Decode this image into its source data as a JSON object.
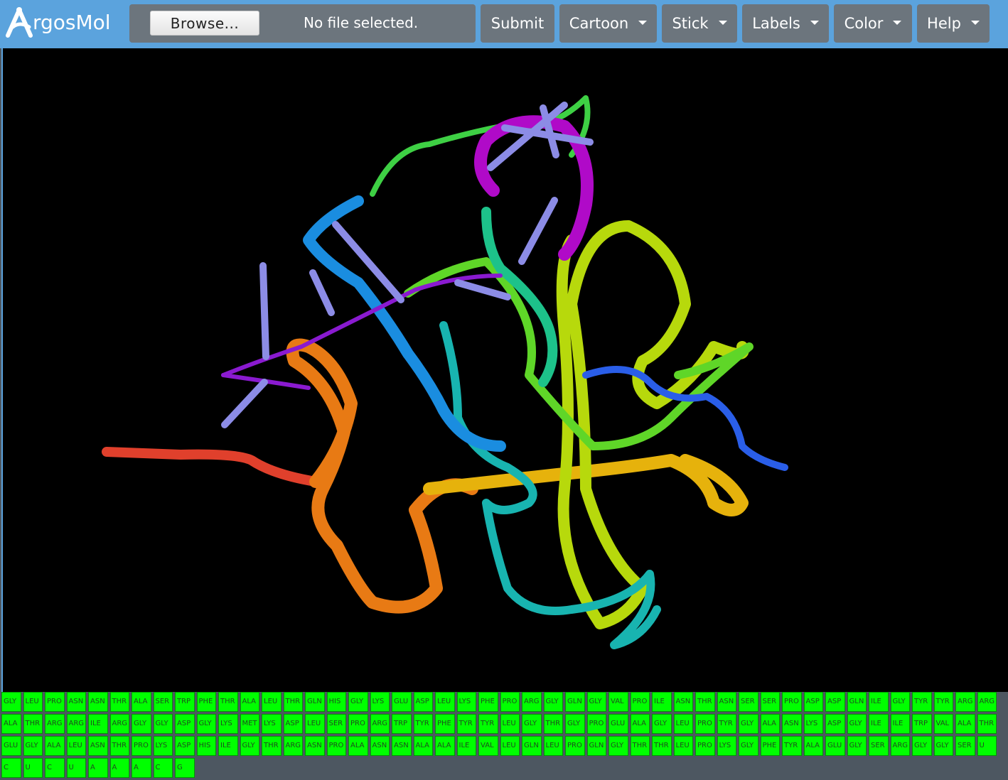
{
  "app": {
    "logo_text": "rgosMol",
    "logo_letter": "A"
  },
  "toolbar": {
    "browse_label": "Browse...",
    "file_status": "No file selected.",
    "submit_label": "Submit",
    "menus": [
      {
        "label": "Cartoon"
      },
      {
        "label": "Stick"
      },
      {
        "label": "Labels"
      },
      {
        "label": "Color"
      },
      {
        "label": "Help"
      }
    ]
  },
  "colors": {
    "navbar": "#5ba3dd",
    "button_bg": "#6c757d",
    "viewer_bg": "#000000",
    "residue_bg": "#00ff00"
  },
  "viewer": {
    "representation": "cartoon",
    "color_scheme": "rainbow"
  },
  "sequence": {
    "rows": [
      [
        "GLY",
        "LEU",
        "PRO",
        "ASN",
        "ASN",
        "THR",
        "ALA",
        "SER",
        "TRP",
        "PHE",
        "THR",
        "ALA",
        "LEU",
        "THR",
        "GLN",
        "HIS",
        "GLY",
        "LYS",
        "GLU",
        "ASP",
        "LEU",
        "LYS",
        "PHE",
        "PRO",
        "ARG",
        "GLY",
        "GLN",
        "GLY",
        "VAL",
        "PRO",
        "ILE",
        "ASN",
        "THR",
        "ASN",
        "SER",
        "SER",
        "PRO",
        "ASP",
        "ASP",
        "GLN",
        "ILE",
        "GLY",
        "TYR",
        "TYR",
        "ARG",
        "ARG"
      ],
      [
        "ALA",
        "THR",
        "ARG",
        "ARG",
        "ILE",
        "ARG",
        "GLY",
        "GLY",
        "ASP",
        "GLY",
        "LYS",
        "MET",
        "LYS",
        "ASP",
        "LEU",
        "SER",
        "PRO",
        "ARG",
        "TRP",
        "TYR",
        "PHE",
        "TYR",
        "TYR",
        "LEU",
        "GLY",
        "THR",
        "GLY",
        "PRO",
        "GLU",
        "ALA",
        "GLY",
        "LEU",
        "PRO",
        "TYR",
        "GLY",
        "ALA",
        "ASN",
        "LYS",
        "ASP",
        "GLY",
        "ILE",
        "ILE",
        "TRP",
        "VAL",
        "ALA",
        "THR"
      ],
      [
        "GLU",
        "GLY",
        "ALA",
        "LEU",
        "ASN",
        "THR",
        "PRO",
        "LYS",
        "ASP",
        "HIS",
        "ILE",
        "GLY",
        "THR",
        "ARG",
        "ASN",
        "PRO",
        "ALA",
        "ASN",
        "ASN",
        "ALA",
        "ALA",
        "ILE",
        "VAL",
        "LEU",
        "GLN",
        "LEU",
        "PRO",
        "GLN",
        "GLY",
        "THR",
        "THR",
        "LEU",
        "PRO",
        "LYS",
        "GLY",
        "PHE",
        "TYR",
        "ALA",
        "GLU",
        "GLY",
        "SER",
        "ARG",
        "GLY",
        "GLY",
        "SER",
        "U"
      ],
      [
        "C",
        "U",
        "C",
        "U",
        "A",
        "A",
        "A",
        "C",
        "G"
      ]
    ]
  }
}
